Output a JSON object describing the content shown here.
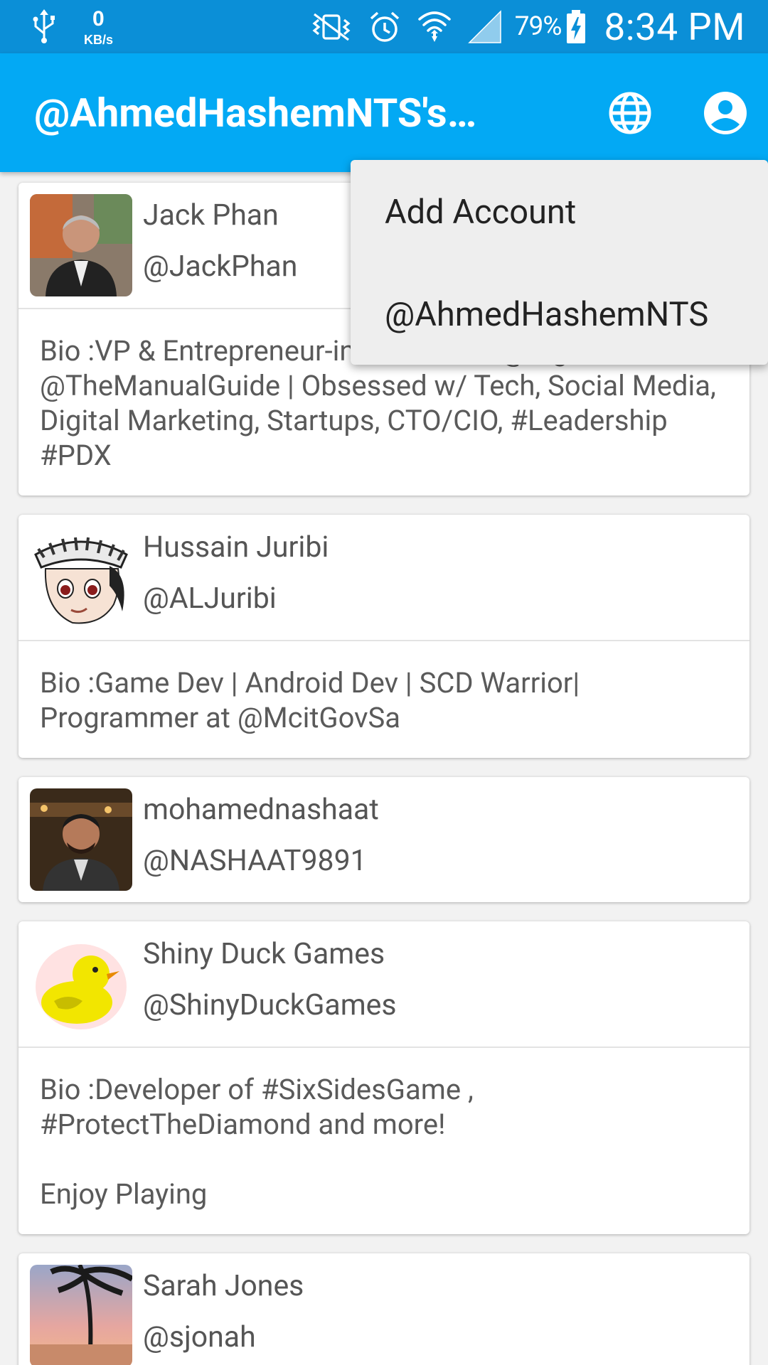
{
  "status_bar": {
    "net_speed_value": "0",
    "net_speed_unit": "KB/s",
    "battery_percent": "79%",
    "time": "8:34 PM",
    "icons": [
      "usb-icon",
      "mute-vibrate-icon",
      "alarm-icon",
      "wifi-icon",
      "signal-icon",
      "battery-charging-icon"
    ]
  },
  "app_bar": {
    "title": "@AhmedHashemNTS's…",
    "background": "#03a9f4",
    "actions": [
      "globe-icon",
      "account-circle-icon"
    ]
  },
  "menu": {
    "items": [
      {
        "label": "Add Account"
      },
      {
        "label": "@AhmedHashemNTS"
      }
    ]
  },
  "users": [
    {
      "name": "Jack Phan",
      "handle": "@JackPhan",
      "bio": "Bio :VP & Entrepreneur-in-Residence @DigitalTrends @TheManualGuide | Obsessed w/ Tech, Social Media, Digital Marketing, Startups, CTO/CIO, #Leadership #PDX",
      "avatar": "photo-man-portrait"
    },
    {
      "name": "Hussain Juribi",
      "handle": "@ALJuribi",
      "bio": "Bio :Game Dev | Android Dev | SCD Warrior| Programmer  at @McitGovSa",
      "avatar": "cartoon-boy-cap"
    },
    {
      "name": "mohamednashaat",
      "handle": "@NASHAAT9891",
      "bio": "",
      "avatar": "photo-man-portrait"
    },
    {
      "name": "Shiny Duck Games",
      "handle": "@ShinyDuckGames",
      "bio": "Bio :Developer of #SixSidesGame , #ProtectTheDiamond and more!\n\nEnjoy Playing",
      "avatar": "yellow-duck"
    },
    {
      "name": "Sarah Jones",
      "handle": "@sjonah",
      "bio": "",
      "avatar": "photo-sunset-palm"
    }
  ]
}
